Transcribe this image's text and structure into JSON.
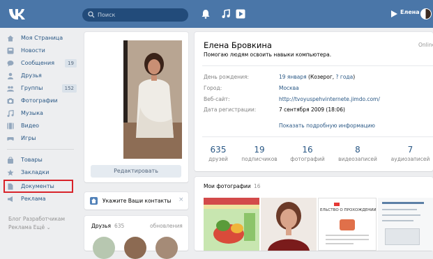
{
  "header": {
    "search_placeholder": "Поиск",
    "username": "Елена",
    "icons": [
      "vk-logo-icon",
      "search-icon",
      "bell-icon",
      "music-note-icon",
      "play-icon",
      "avatar"
    ]
  },
  "sidebar": {
    "items": [
      {
        "label": "Моя Страница",
        "icon": "home-icon"
      },
      {
        "label": "Новости",
        "icon": "news-icon"
      },
      {
        "label": "Сообщения",
        "icon": "messages-icon",
        "count": "19"
      },
      {
        "label": "Друзья",
        "icon": "friends-icon"
      },
      {
        "label": "Группы",
        "icon": "groups-icon",
        "count": "152"
      },
      {
        "label": "Фотографии",
        "icon": "camera-icon"
      },
      {
        "label": "Музыка",
        "icon": "music-icon"
      },
      {
        "label": "Видео",
        "icon": "video-icon"
      },
      {
        "label": "Игры",
        "icon": "games-icon"
      },
      {
        "label": "Товары",
        "icon": "goods-icon"
      },
      {
        "label": "Закладки",
        "icon": "star-icon"
      },
      {
        "label": "Документы",
        "icon": "document-icon"
      },
      {
        "label": "Реклама",
        "icon": "ads-icon"
      }
    ],
    "footer_line1": "Блог  Разработчикам",
    "footer_line2": "Реклама  Ещё ⌄"
  },
  "left_column": {
    "edit_label": "Редактировать",
    "contacts_label": "Укажите Ваши контакты",
    "friends_label": "Друзья",
    "friends_count": "635",
    "friends_updates": "обновления"
  },
  "profile": {
    "name": "Елена Бровкина",
    "status": "Помогаю людям освоить навыки компьютера.",
    "online": "Online",
    "fields": [
      {
        "label": "День рождения:",
        "value": "19 января",
        "extra": " (Козерог, ",
        "extra_link": "? года",
        "extra_end": ")"
      },
      {
        "label": "Город:",
        "value": "Москва"
      },
      {
        "label": "Веб-сайт:",
        "value": "http://tvoyuspehvinternete.jimdo.com/"
      },
      {
        "label": "Дата регистрации:",
        "value": "7 сентября 2009 (18:06)"
      }
    ],
    "more_info": "Показать подробную информацию",
    "stats": [
      {
        "value": "635",
        "label": "друзей"
      },
      {
        "value": "19",
        "label": "подписчиков"
      },
      {
        "value": "16",
        "label": "фотографий"
      },
      {
        "value": "8",
        "label": "видеозаписей"
      },
      {
        "value": "7",
        "label": "аудиозаписей"
      }
    ]
  },
  "photos": {
    "title": "Мои фотографии",
    "count": "16",
    "thumb3_text": "ЕЛЬСТВО О ПРОХОЖДЕНИИ"
  },
  "colors": {
    "header": "#4a76a8",
    "link": "#2a5885",
    "highlight": "#d8232a",
    "background": "#edeef0"
  }
}
